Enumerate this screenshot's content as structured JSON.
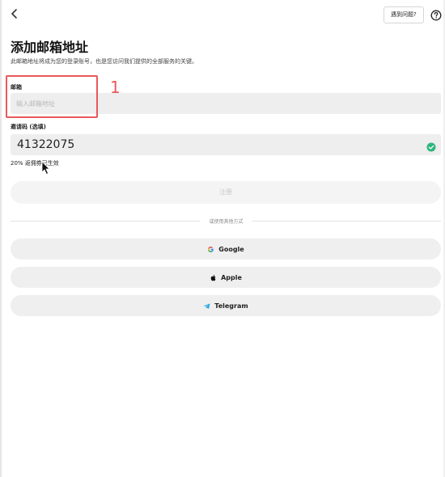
{
  "header": {
    "back_icon": "chevron-left-icon",
    "help_label": "遇到问题?",
    "help_icon": "question-circle-icon"
  },
  "page": {
    "title": "添加邮箱地址",
    "subtitle": "此邮箱地址将成为您的登录账号，也是您访问我们提供的全部服务的关键。"
  },
  "email": {
    "label": "邮箱",
    "placeholder": "输入邮箱地址",
    "value": ""
  },
  "invite": {
    "label": "邀请码 (选填)",
    "value": "41322075",
    "status": "20% 返佣券已生效",
    "valid_icon": "check-circle-icon"
  },
  "annotation": {
    "number": "1",
    "color": "#e8595b"
  },
  "register": {
    "label": "注册"
  },
  "divider": {
    "text": "或使用其他方式"
  },
  "social": {
    "google": "Google",
    "apple": "Apple",
    "telegram": "Telegram"
  },
  "colors": {
    "check_green": "#2eb67d",
    "telegram_blue": "#2aa3df",
    "input_bg": "#eeeeee"
  }
}
